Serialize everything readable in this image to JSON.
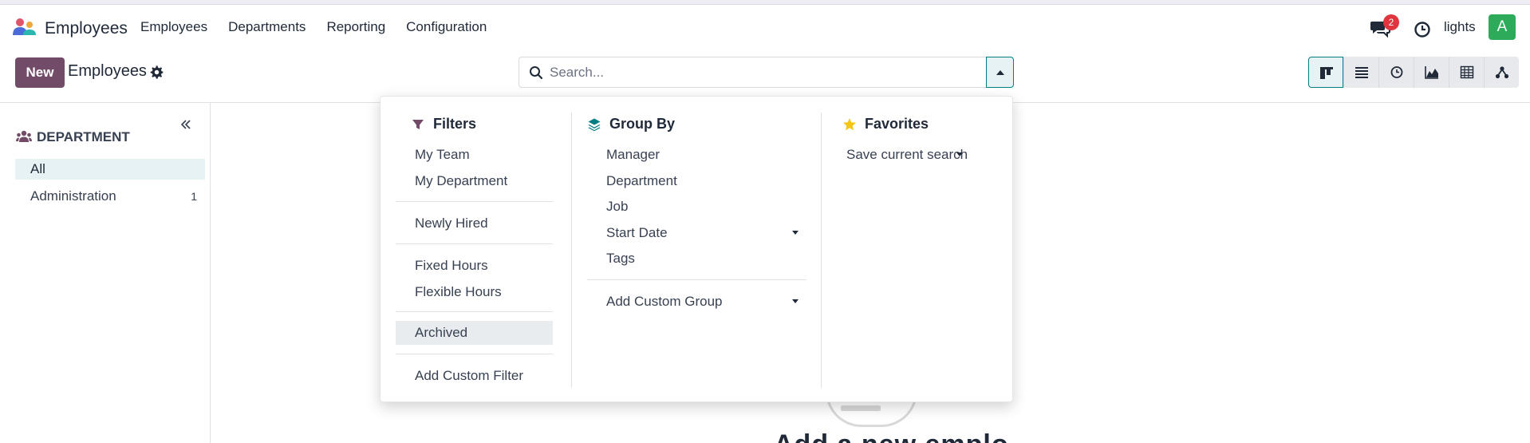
{
  "app": {
    "name": "Employees"
  },
  "menu": [
    "Employees",
    "Departments",
    "Reporting",
    "Configuration"
  ],
  "systray": {
    "chat_count": "2",
    "user_name": "lights",
    "avatar_letter": "A",
    "avatar_color": "#2eab5a"
  },
  "control_panel": {
    "new_label": "New",
    "title": "Employees",
    "search_placeholder": "Search..."
  },
  "sidebar": {
    "heading": "DEPARTMENT",
    "items": [
      {
        "label": "All",
        "count": ""
      },
      {
        "label": "Administration",
        "count": "1"
      }
    ]
  },
  "dropdown": {
    "filters": {
      "heading": "Filters",
      "items": [
        "My Team",
        "My Department",
        "Newly Hired",
        "Fixed Hours",
        "Flexible Hours",
        "Archived",
        "Add Custom Filter"
      ]
    },
    "group_by": {
      "heading": "Group By",
      "items": [
        "Manager",
        "Department",
        "Job",
        "Start Date",
        "Tags",
        "Add Custom Group"
      ]
    },
    "favorites": {
      "heading": "Favorites",
      "items": [
        "Save current search"
      ]
    }
  },
  "background": {
    "heading_fragment": "Add a new emplo"
  },
  "colors": {
    "brand": "#714b67",
    "accent": "#017e84",
    "badge": "#e0343f",
    "star": "#f3c614"
  }
}
